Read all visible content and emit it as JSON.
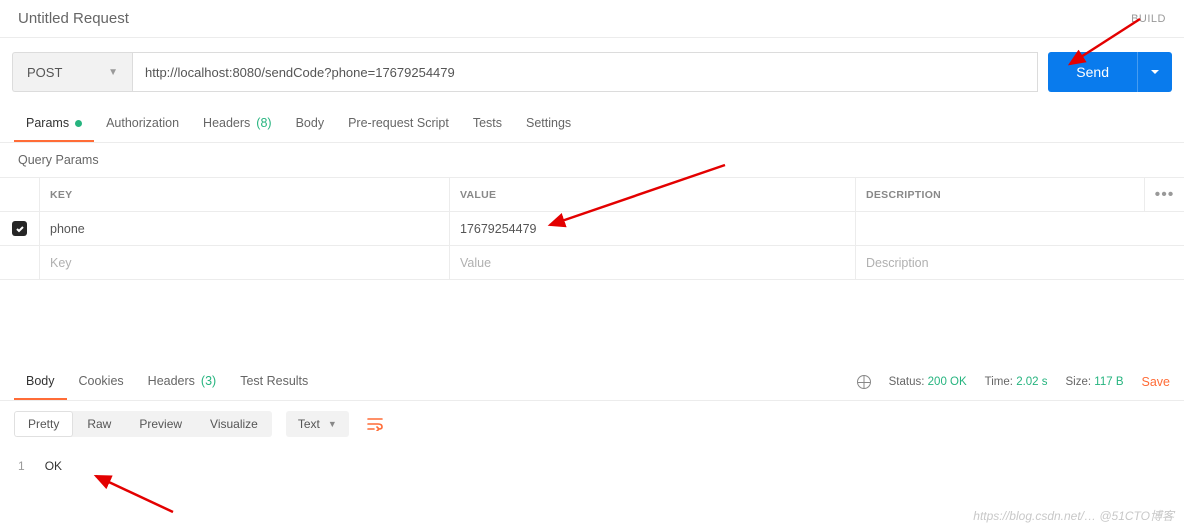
{
  "request": {
    "title": "Untitled Request",
    "build_label": "BUILD",
    "method": "POST",
    "url": "http://localhost:8080/sendCode?phone=17679254479",
    "send_label": "Send"
  },
  "tabs": {
    "params": "Params",
    "authorization": "Authorization",
    "headers": "Headers",
    "headers_count": "(8)",
    "body": "Body",
    "prerequest": "Pre-request Script",
    "tests": "Tests",
    "settings": "Settings"
  },
  "query_params": {
    "section_label": "Query Params",
    "columns": {
      "key": "KEY",
      "value": "VALUE",
      "description": "DESCRIPTION"
    },
    "row": {
      "key": "phone",
      "value": "17679254479",
      "description": ""
    },
    "placeholders": {
      "key": "Key",
      "value": "Value",
      "description": "Description"
    }
  },
  "response": {
    "tabs": {
      "body": "Body",
      "cookies": "Cookies",
      "headers": "Headers",
      "headers_count": "(3)",
      "test_results": "Test Results"
    },
    "status_label": "Status:",
    "status_value": "200 OK",
    "time_label": "Time:",
    "time_value": "2.02 s",
    "size_label": "Size:",
    "size_value": "117 B",
    "save_label": "Save",
    "view_modes": {
      "pretty": "Pretty",
      "raw": "Raw",
      "preview": "Preview",
      "visualize": "Visualize"
    },
    "format": "Text",
    "body_line_no": "1",
    "body_text": "OK"
  },
  "watermark": "https://blog.csdn.net/… @51CTO博客"
}
